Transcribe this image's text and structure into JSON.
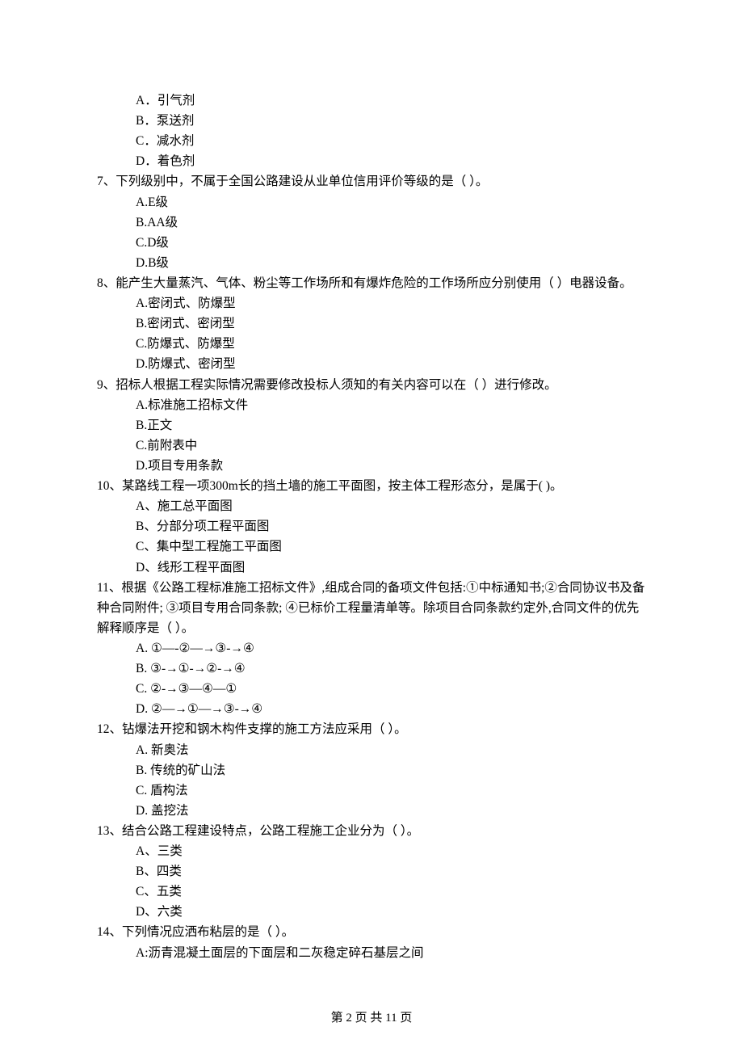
{
  "pre_options": [
    "A．引气剂",
    "B．泵送剂",
    "C．减水剂",
    "D．着色剂"
  ],
  "questions": [
    {
      "stem": "7、下列级别中，不属于全国公路建设从业单位信用评价等级的是（    ）。",
      "options": [
        "A.E级",
        "B.AA级",
        "C.D级",
        "D.B级"
      ]
    },
    {
      "stem": "8、能产生大量蒸汽、气体、粉尘等工作场所和有爆炸危险的工作场所应分别使用（    ）电器设备。",
      "options": [
        "A.密闭式、防爆型",
        "B.密闭式、密闭型",
        "C.防爆式、防爆型",
        "D.防爆式、密闭型"
      ]
    },
    {
      "stem": "9、招标人根据工程实际情况需要修改投标人须知的有关内容可以在（    ）进行修改。",
      "options": [
        "A.标准施工招标文件",
        "B.正文",
        "C.前附表中",
        "D.项目专用条款"
      ]
    },
    {
      "stem": "10、某路线工程一项300m长的挡土墙的施工平面图，按主体工程形态分，是属于(   )。",
      "options": [
        "A、施工总平面图",
        "B、分部分项工程平面图",
        "C、集中型工程施工平面图",
        "D、线形工程平面图"
      ]
    },
    {
      "stem": "11、根据《公路工程标准施工招标文件》,组成合同的备项文件包括:①中标通知书;②合同协议书及备种合同附件; ③项目专用合同条款; ④已标价工程量清单等。除项目合同条款约定外,合同文件的优先解释顺序是（    ）。",
      "options": [
        "A. ①—-②—→③-→④",
        "B. ③-→①-→②-→④",
        "C. ②-→③—④—①",
        "D. ②—→①—→③-→④"
      ]
    },
    {
      "stem": "12、钻爆法开挖和钢木构件支撑的施工方法应采用（    ）。",
      "options": [
        "A. 新奥法",
        "B. 传统的矿山法",
        "C. 盾构法",
        "D. 盖挖法"
      ]
    },
    {
      "stem": "13、结合公路工程建设特点，公路工程施工企业分为（    ）。",
      "options": [
        "A、三类",
        "B、四类",
        "C、五类",
        "D、六类"
      ]
    },
    {
      "stem": "14、下列情况应洒布粘层的是（    ）。",
      "options": [
        "A:沥青混凝土面层的下面层和二灰稳定碎石基层之间"
      ]
    }
  ],
  "footer": "第 2 页 共 11 页"
}
